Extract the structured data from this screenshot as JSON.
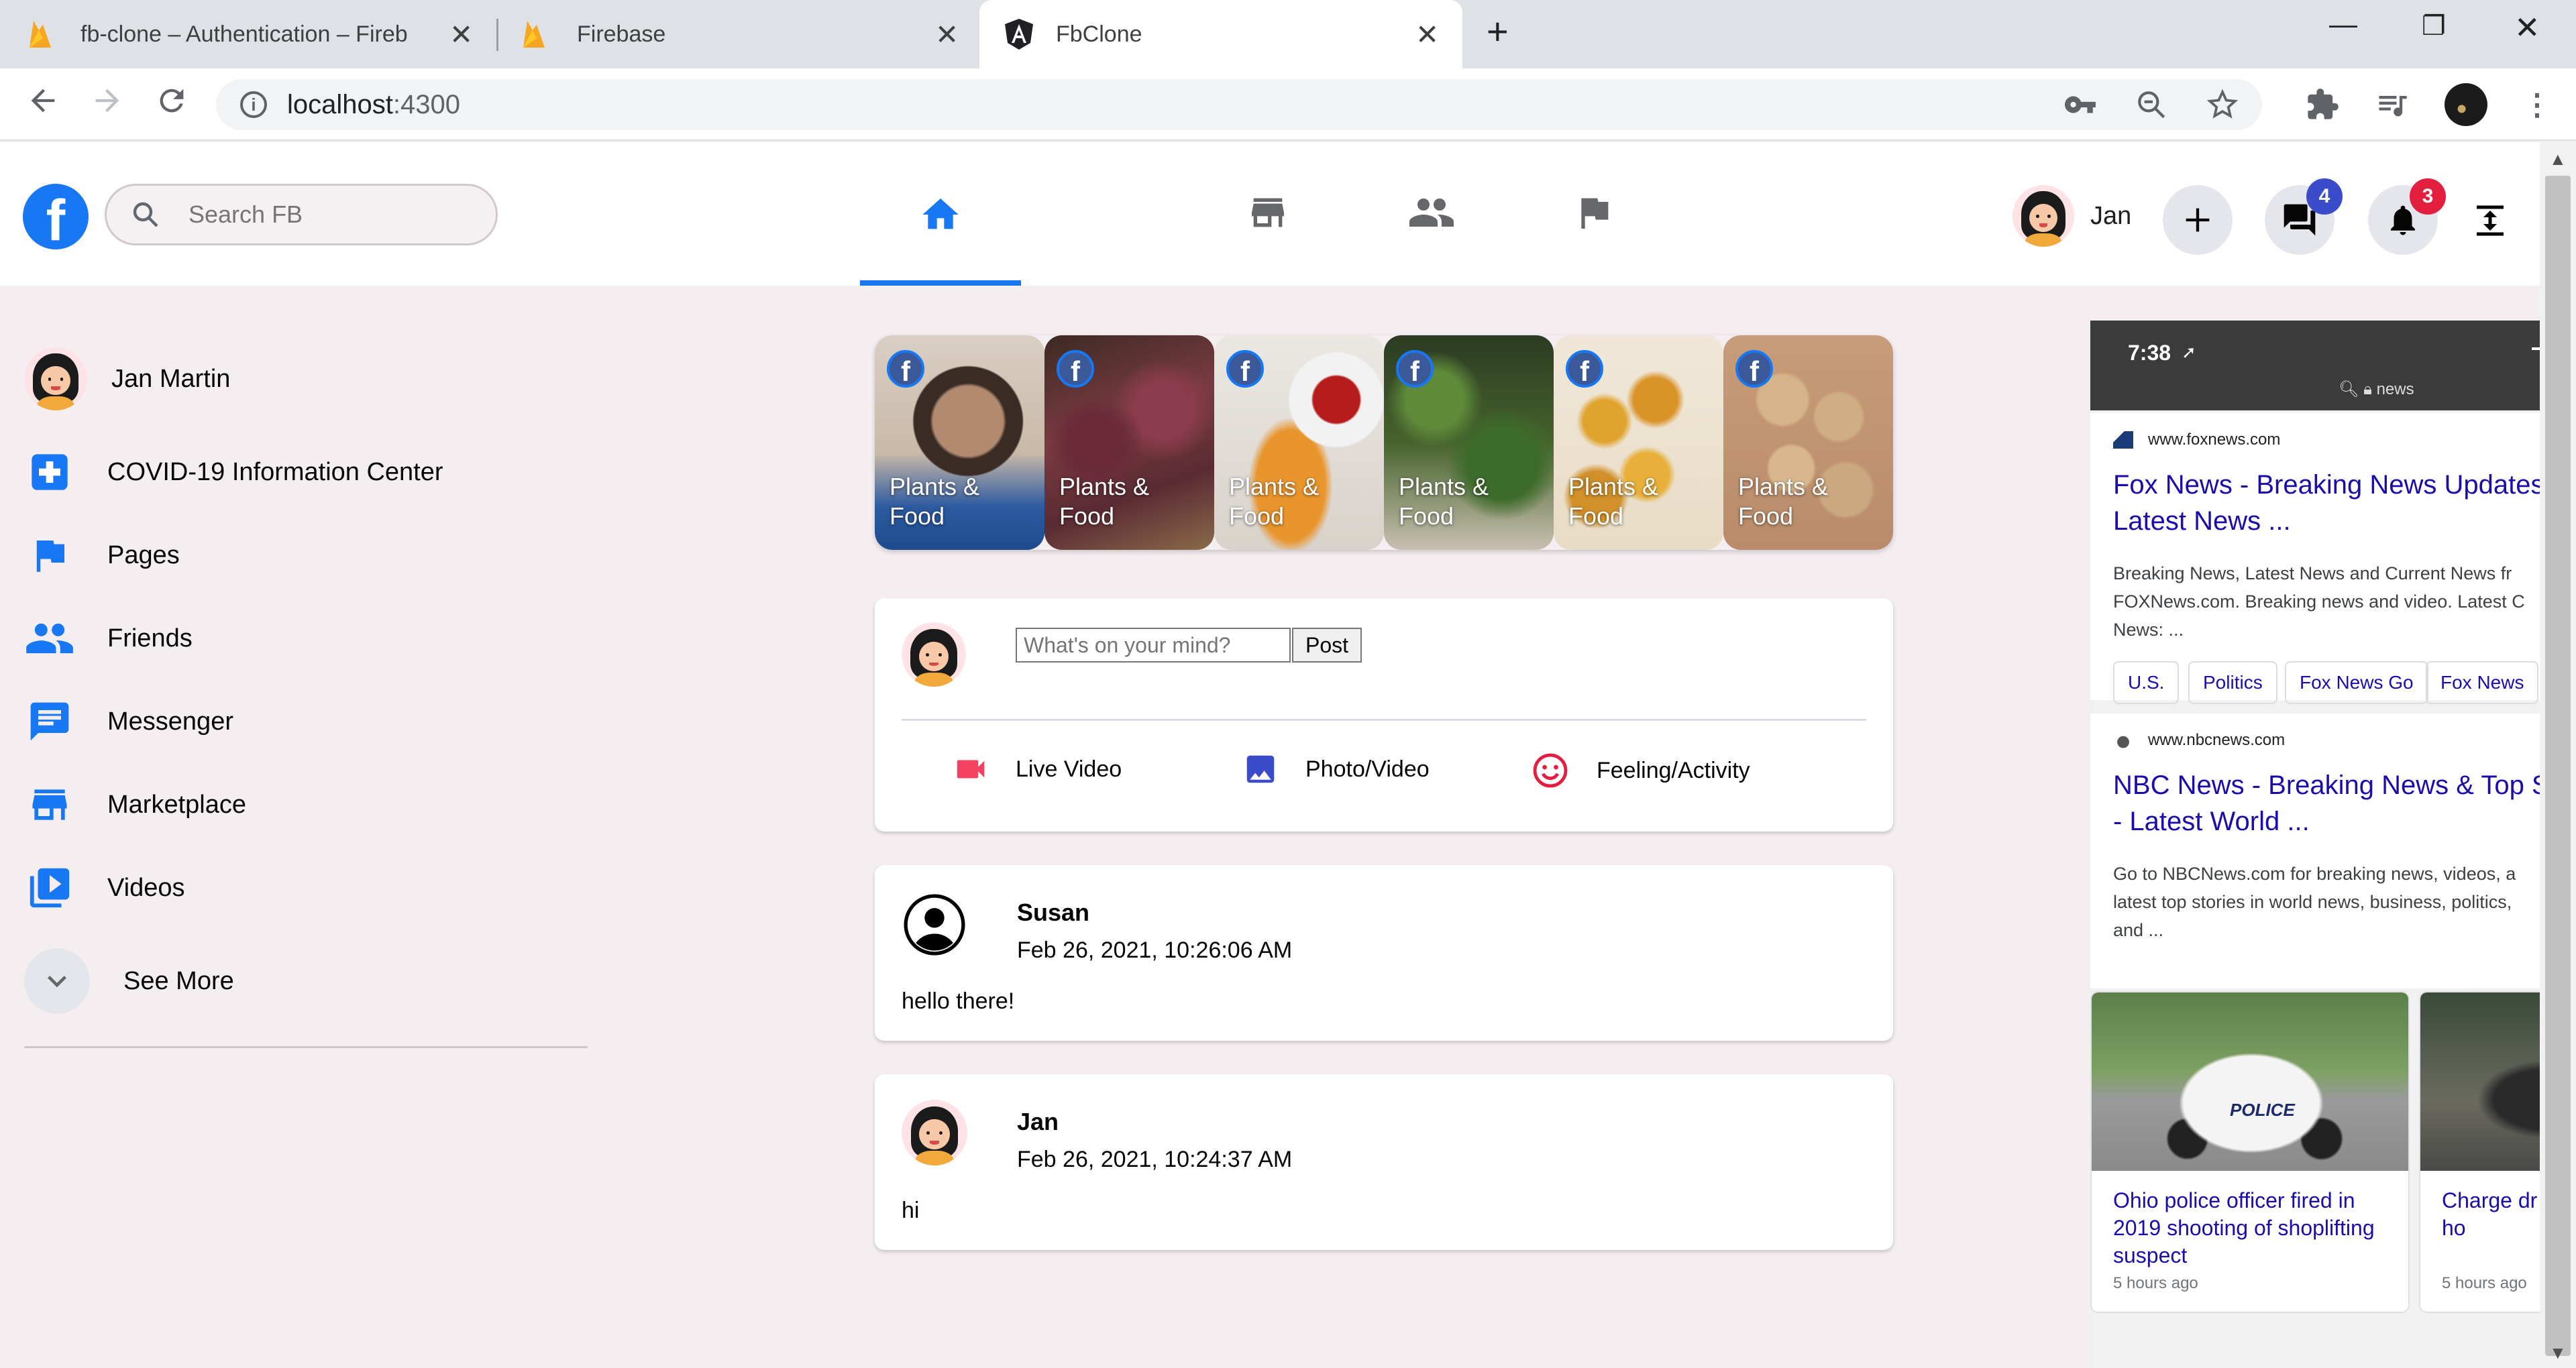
{
  "browser": {
    "tabs": [
      {
        "title": "fb-clone – Authentication – Fireb",
        "icon": "firebase-icon"
      },
      {
        "title": "Firebase",
        "icon": "firebase-icon"
      },
      {
        "title": "FbClone",
        "icon": "angular-icon"
      }
    ],
    "new_tab": "+",
    "url_host": "localhost",
    "url_port": ":4300"
  },
  "header": {
    "search_placeholder": "Search FB",
    "user_name": "Jan",
    "messages_badge": "4",
    "notifications_badge": "3",
    "colors": {
      "accent": "#1877f2",
      "badge_blue": "#3b4cca",
      "badge_red": "#e41e3f"
    }
  },
  "sidebar": {
    "items": [
      {
        "label": "Jan Martin",
        "icon": "avatar"
      },
      {
        "label": "COVID-19 Information Center",
        "icon": "medical-cross-icon"
      },
      {
        "label": "Pages",
        "icon": "flag-icon"
      },
      {
        "label": "Friends",
        "icon": "people-icon"
      },
      {
        "label": "Messenger",
        "icon": "chat-icon"
      },
      {
        "label": "Marketplace",
        "icon": "store-icon"
      },
      {
        "label": "Videos",
        "icon": "video-library-icon"
      },
      {
        "label": "See More",
        "icon": "chevron-down-icon"
      }
    ]
  },
  "stories": [
    {
      "label": "Plants & Food"
    },
    {
      "label": "Plants & Food"
    },
    {
      "label": "Plants & Food"
    },
    {
      "label": "Plants & Food"
    },
    {
      "label": "Plants & Food"
    },
    {
      "label": "Plants & Food"
    }
  ],
  "composer": {
    "placeholder": "What's on your mind?",
    "post_button": "Post",
    "actions": [
      {
        "label": "Live Video",
        "icon": "videocam-icon",
        "color": "#f3425f"
      },
      {
        "label": "Photo/Video",
        "icon": "photo-icon",
        "color": "#3b4cca"
      },
      {
        "label": "Feeling/Activity",
        "icon": "smiley-icon",
        "color": "#e41e3f"
      }
    ]
  },
  "posts": [
    {
      "author": "Susan",
      "timestamp": "Feb 26, 2021, 10:26:06 AM",
      "text": "hello there!",
      "avatar": "default-user-icon"
    },
    {
      "author": "Jan",
      "timestamp": "Feb 26, 2021, 10:24:37 AM",
      "text": "hi",
      "avatar": "avatar"
    }
  ],
  "right_panel": {
    "status_time": "7:38",
    "query": "news",
    "results": [
      {
        "source": "www.foxnews.com",
        "title": "Fox News - Breaking News Updates\nLatest News ...",
        "snippet": "Breaking News, Latest News and Current News fr\nFOXNews.com. Breaking news and video. Latest C\nNews: ...",
        "chips": [
          "U.S.",
          "Politics",
          "Fox News Go",
          "Fox News"
        ]
      },
      {
        "source": "www.nbcnews.com",
        "title": "NBC News - Breaking News & Top S\n- Latest World ...",
        "snippet": "Go to NBCNews.com for breaking news, videos, a\nlatest top stories in world news, business, politics,\nand ..."
      }
    ],
    "news_cards": [
      {
        "title": "Ohio police officer fired in 2019 shooting of shoplifting suspect",
        "meta": "5 hours ago"
      },
      {
        "title": "Charge dr Black teen walking ho",
        "meta": "5 hours ago"
      }
    ]
  }
}
